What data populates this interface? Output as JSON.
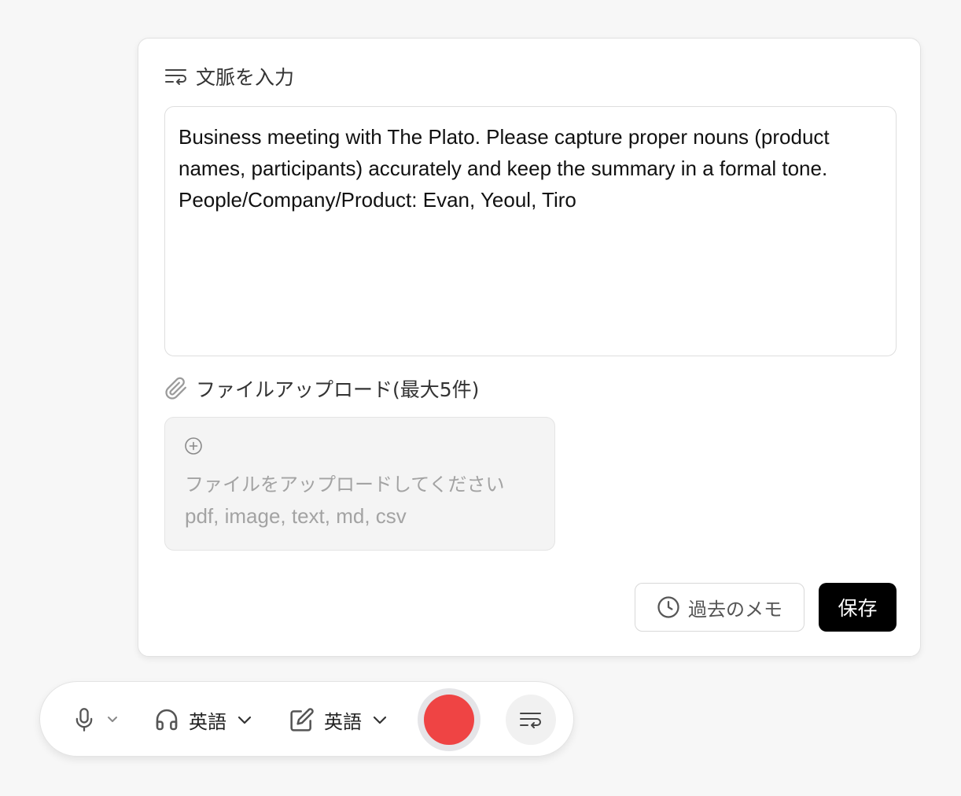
{
  "context_panel": {
    "title": "文脈を入力",
    "context_text": "Business meeting with The Plato. Please capture proper nouns (product names, participants) accurately and keep the summary in a formal tone. People/Company/Product: Evan, Yeoul, Tiro",
    "upload_label": "ファイルアップロード(最大5件)",
    "upload_prompt": "ファイルをアップロードしてください",
    "upload_types": "pdf, image, text, md, csv",
    "history_button": "過去のメモ",
    "save_button": "保存"
  },
  "toolbar": {
    "listen_language": "英語",
    "write_language": "英語"
  },
  "colors": {
    "record": "#ef4444",
    "save_button": "#000000",
    "upload_bg": "#f4f4f4",
    "placeholder_text": "#a3a3a3"
  },
  "icons": [
    "text-wrap-icon",
    "paperclip-icon",
    "plus-circle-icon",
    "clock-icon",
    "microphone-icon",
    "chevron-down-icon",
    "headphones-icon",
    "edit-icon",
    "record-icon"
  ]
}
